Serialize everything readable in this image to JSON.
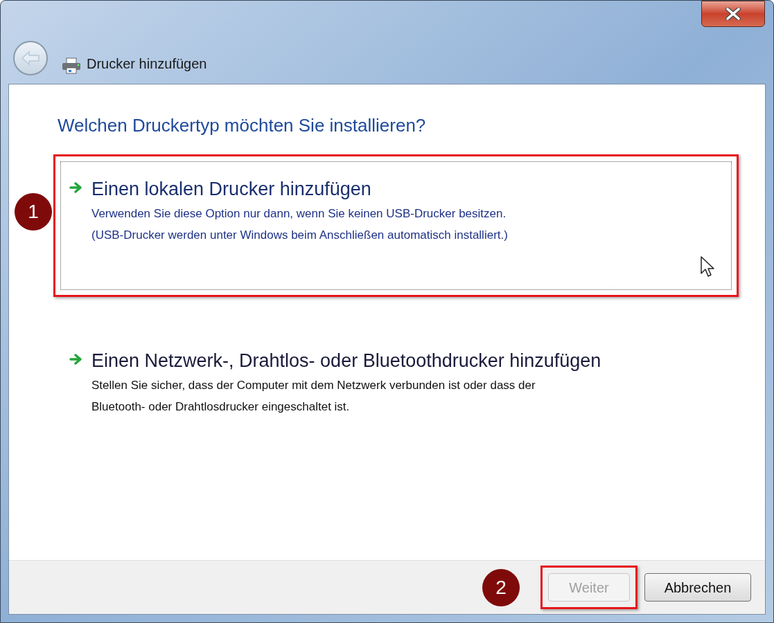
{
  "window": {
    "title": "Drucker hinzufügen"
  },
  "heading": "Welchen Druckertyp möchten Sie installieren?",
  "options": [
    {
      "title": "Einen lokalen Drucker hinzufügen",
      "description": "Verwenden Sie diese Option nur dann, wenn Sie keinen USB-Drucker besitzen.\n(USB-Drucker werden unter Windows beim Anschließen automatisch installiert.)",
      "selected": true,
      "annotation": "1"
    },
    {
      "title": "Einen Netzwerk-, Drahtlos- oder Bluetoothdrucker hinzufügen",
      "description": "Stellen Sie sicher, dass der Computer mit dem Netzwerk verbunden ist oder dass der\nBluetooth- oder Drahtlosdrucker eingeschaltet ist.",
      "selected": false
    }
  ],
  "buttons": [
    {
      "label": "Weiter",
      "disabled": true,
      "annotation": "2"
    },
    {
      "label": "Abbrechen",
      "disabled": false
    }
  ]
}
